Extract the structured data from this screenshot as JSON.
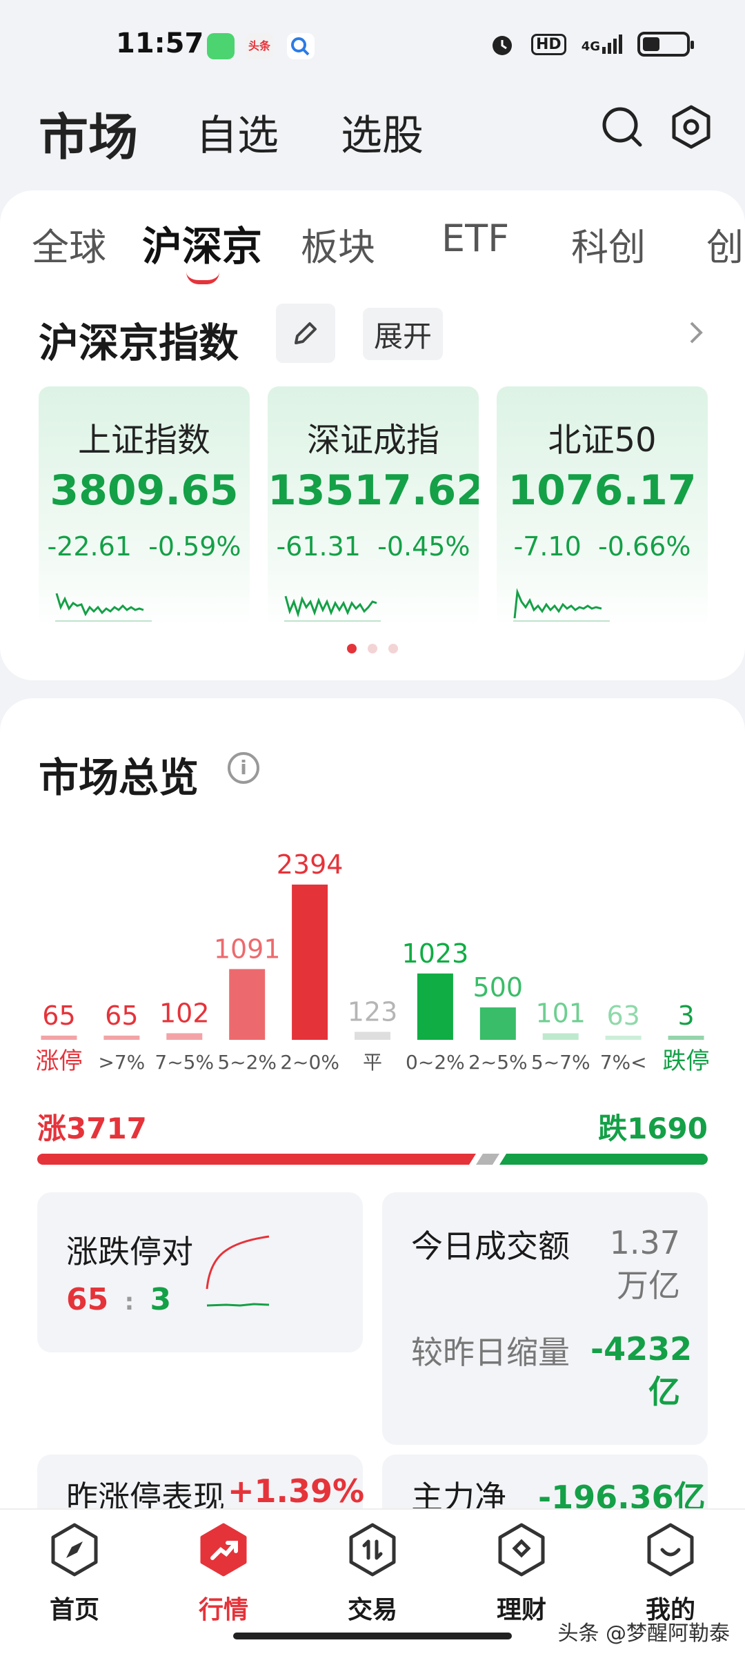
{
  "status_bar": {
    "time": "11:57",
    "apps": [
      "messages-icon",
      "toutiao-icon",
      "search-app-icon"
    ],
    "toutiao_text": "头条",
    "hd": "HD",
    "network": "4G"
  },
  "header": {
    "tabs": [
      "市场",
      "自选",
      "选股"
    ],
    "active": "市场"
  },
  "subtabs": [
    "全球",
    "沪深京",
    "板块",
    "ETF",
    "科创",
    "创"
  ],
  "index_section": {
    "title": "沪深京指数",
    "expand_label": "展开",
    "cards": [
      {
        "name": "上证指数",
        "value": "3809.65",
        "change": "-22.61",
        "pct": "-0.59%"
      },
      {
        "name": "深证成指",
        "value": "13517.62",
        "change": "-61.31",
        "pct": "-0.45%"
      },
      {
        "name": "北证50",
        "value": "1076.17",
        "change": "-7.10",
        "pct": "-0.66%"
      }
    ]
  },
  "overview": {
    "title": "市场总览",
    "rise_label": "涨3717",
    "fall_label": "跌1690",
    "limit_card": {
      "title": "涨跌停对",
      "up": "65",
      "sep": ":",
      "down": "3"
    },
    "volume_card": {
      "label": "今日成交额",
      "value": "1.37万亿",
      "compare_label": "较昨日缩量",
      "compare_value": "-4232亿"
    },
    "yesterday_card": {
      "label": "昨涨停表现",
      "value": "+1.39%"
    },
    "main_card": {
      "label": "主力净",
      "value": "-196.36亿"
    }
  },
  "chart_data": {
    "type": "bar",
    "title": "",
    "categories": [
      "涨停",
      ">7%",
      "7~5%",
      "5~2%",
      "2~0%",
      "平",
      "0~2%",
      "2~5%",
      "5~7%",
      "7%<",
      "跌停"
    ],
    "values": [
      65,
      65,
      102,
      1091,
      2394,
      123,
      1023,
      500,
      101,
      63,
      3
    ],
    "colors": [
      "#e5333a",
      "#e5333a",
      "#e5333a",
      "#ec6a6e",
      "#e5333a",
      "#b5b5b5",
      "#0fad43",
      "#39bd68",
      "#6ecf91",
      "#8fd9aa",
      "#14a047"
    ],
    "category_colors": [
      "#e5333a",
      "#555555",
      "#555555",
      "#555555",
      "#555555",
      "#555555",
      "#555555",
      "#555555",
      "#555555",
      "#555555",
      "#14a047"
    ],
    "ylim": [
      0,
      2394
    ]
  },
  "bottom_nav": {
    "items": [
      {
        "label": "首页",
        "icon": "compass-icon"
      },
      {
        "label": "行情",
        "icon": "trend-icon"
      },
      {
        "label": "交易",
        "icon": "trade-icon"
      },
      {
        "label": "理财",
        "icon": "wealth-icon"
      },
      {
        "label": "我的",
        "icon": "profile-icon"
      }
    ],
    "active": "行情"
  },
  "watermark": "头条 @梦醒阿勒泰"
}
